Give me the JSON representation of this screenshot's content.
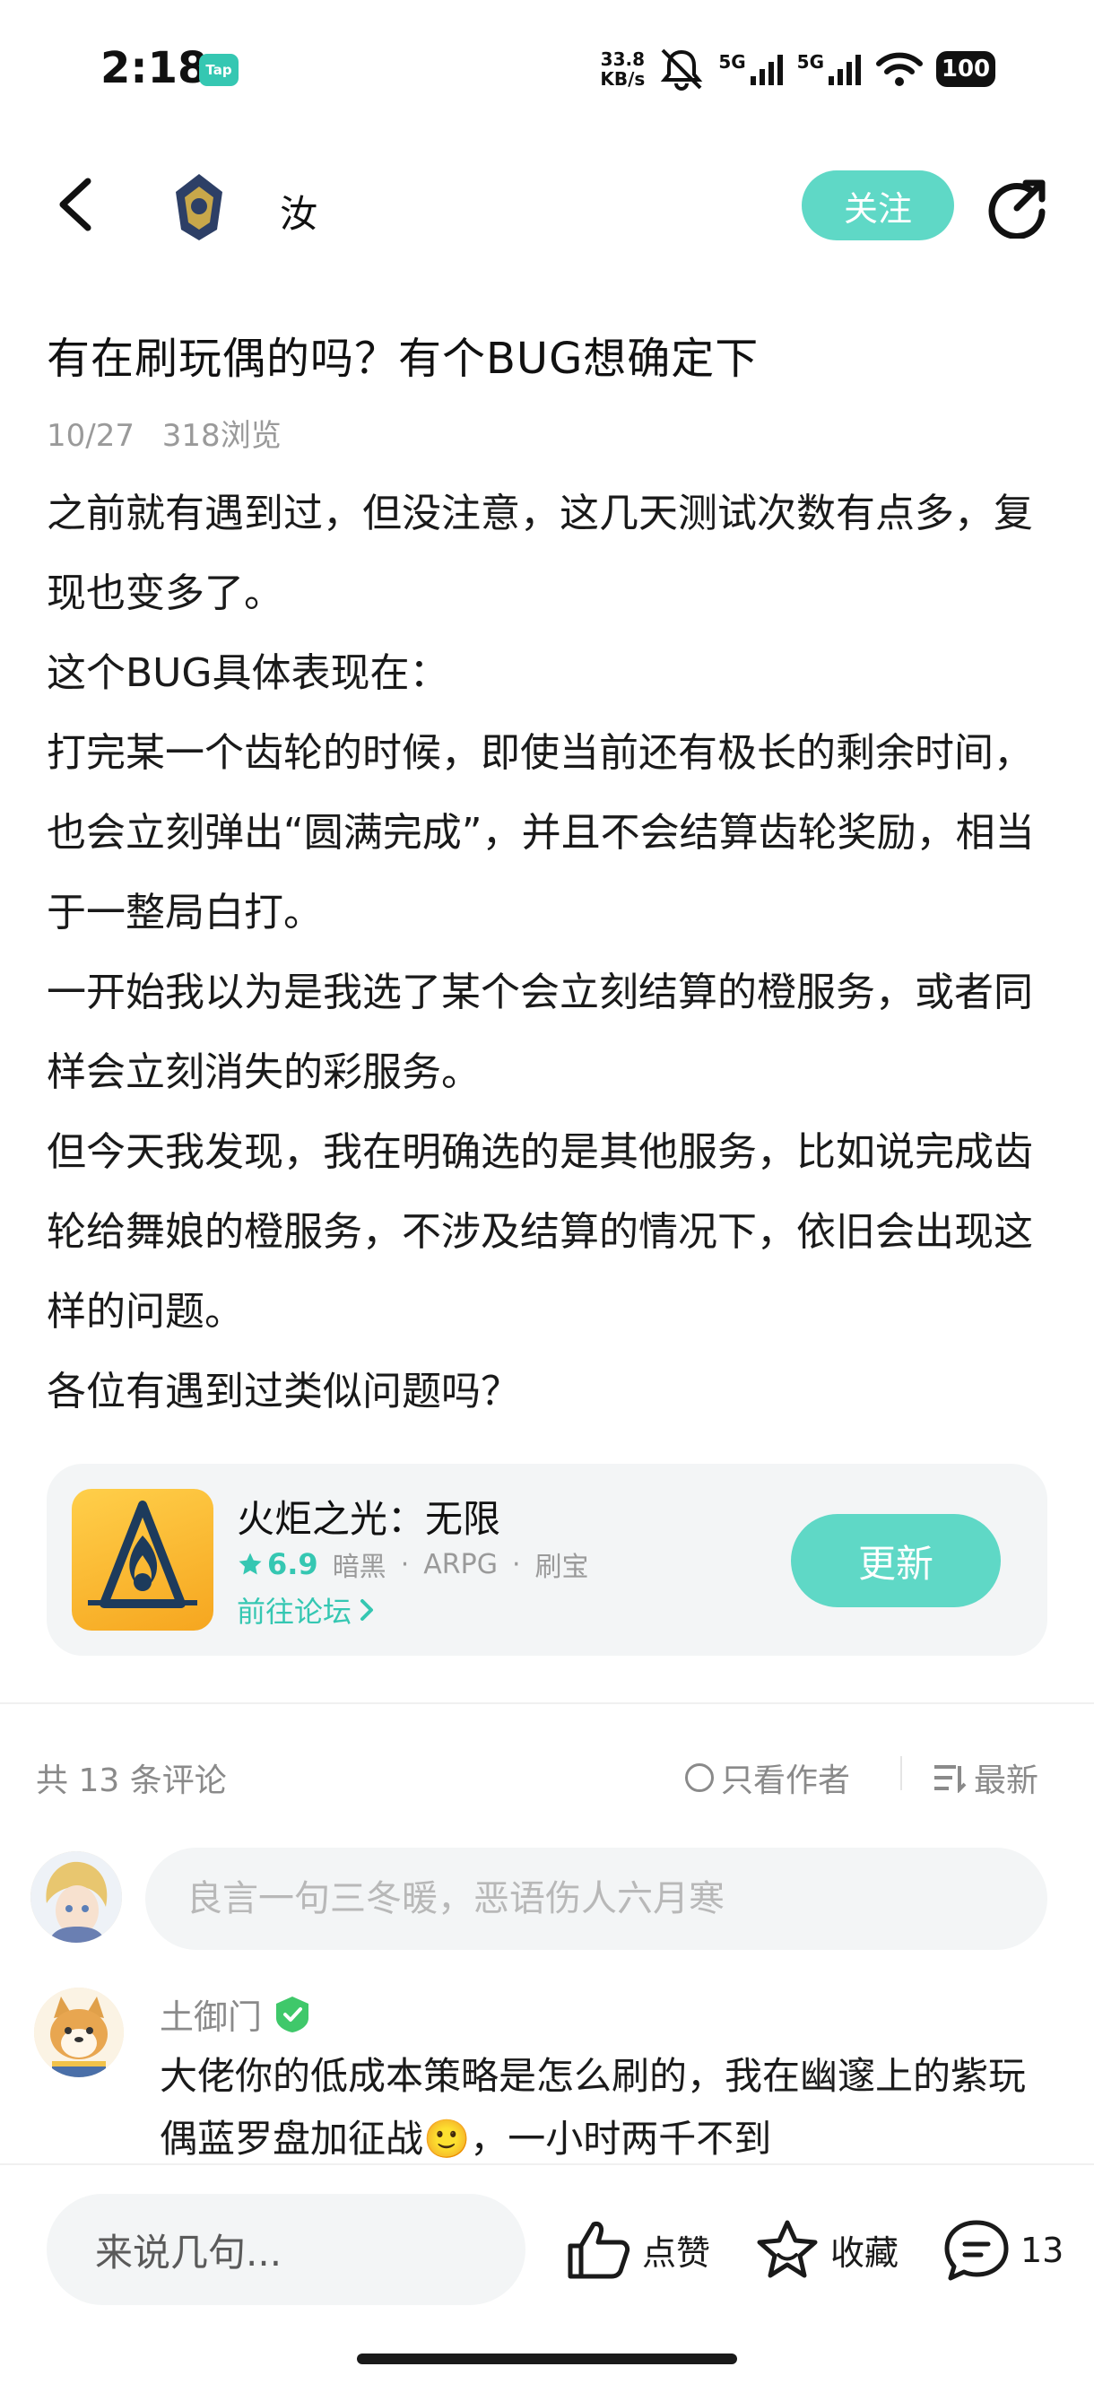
{
  "status_bar": {
    "time": "2:18",
    "app_badge": "Tap",
    "net_speed_value": "33.8",
    "net_speed_unit": "KB/s",
    "signal_1": "5G",
    "signal_2": "5G",
    "battery": "100"
  },
  "header": {
    "author_name": "汝",
    "follow_label": "关注"
  },
  "post": {
    "title": "有在刷玩偶的吗？有个BUG想确定下",
    "date": "10/27",
    "views": "318浏览",
    "paragraphs": [
      "之前就有遇到过，但没注意，这几天测试次数有点多，复现也变多了。",
      "这个BUG具体表现在：",
      "打完某一个齿轮的时候，即使当前还有极长的剩余时间，也会立刻弹出“圆满完成”，并且不会结算齿轮奖励，相当于一整局白打。",
      "一开始我以为是我选了某个会立刻结算的橙服务，或者同样会立刻消失的彩服务。",
      "但今天我发现，我在明确选的是其他服务，比如说完成齿轮给舞娘的橙服务，不涉及结算的情况下，依旧会出现这样的问题。",
      "各位有遇到过类似问题吗？"
    ]
  },
  "game_card": {
    "name": "火炬之光：无限",
    "rating": "6.9",
    "tags": [
      "暗黑",
      "ARPG",
      "刷宝"
    ],
    "forum_link": "前往论坛",
    "update_label": "更新"
  },
  "comments_header": {
    "count_text": "共 13 条评论",
    "only_author": "只看作者",
    "sort_label": "最新"
  },
  "comment_input": {
    "placeholder": "良言一句三冬暖，恶语伤人六月寒"
  },
  "comments": [
    {
      "username": "土御门",
      "text": "大佬你的低成本策略是怎么刷的，我在幽邃上的紫玩偶蓝罗盘加征战🙂，一小时两千不到"
    }
  ],
  "bottom_bar": {
    "input_label": "来说几句...",
    "like_label": "点赞",
    "collect_label": "收藏",
    "comment_count": "13"
  }
}
